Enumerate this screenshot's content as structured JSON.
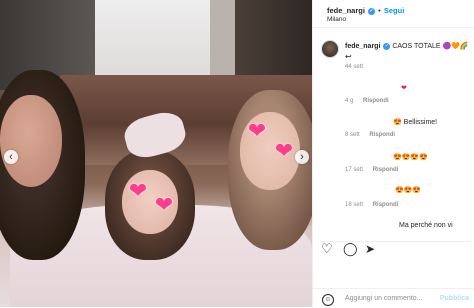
{
  "photo": {
    "hearts": [
      "❤",
      "❤",
      "❤",
      "❤"
    ],
    "prev_glyph": "‹",
    "next_glyph": "›"
  },
  "header": {
    "username": "fede_nargi",
    "separator": "•",
    "follow_label": "Segui",
    "location": "Milano"
  },
  "caption": {
    "username": "fede_nargi",
    "text": "CAOS TOTALE 🟣🧡🌈",
    "arrow": "↩",
    "time": "44 sett"
  },
  "comments": [
    {
      "text": "❤",
      "time": "4 g",
      "reply": "Rispondi"
    },
    {
      "text": "😍 Bellissime!",
      "time": "8 sett",
      "reply": "Rispondi"
    },
    {
      "text": "😍😍😍😍",
      "time": "17 sett",
      "reply": "Rispondi"
    },
    {
      "text": "😍😍😍",
      "time": "18 sett",
      "reply": "Rispondi"
    },
    {
      "text": "Ma perché non vi",
      "time": "",
      "reply": ""
    }
  ],
  "actions": {
    "like_icon": "heart-outline",
    "comment_icon": "speech-bubble",
    "share_icon": "paper-plane"
  },
  "add_comment": {
    "placeholder": "Aggiungi un commento...",
    "publish_label": "Pubblica"
  },
  "colors": {
    "accent": "#0095f6",
    "verified": "#3897f0",
    "heart_sticker": "#ff3d8a"
  }
}
